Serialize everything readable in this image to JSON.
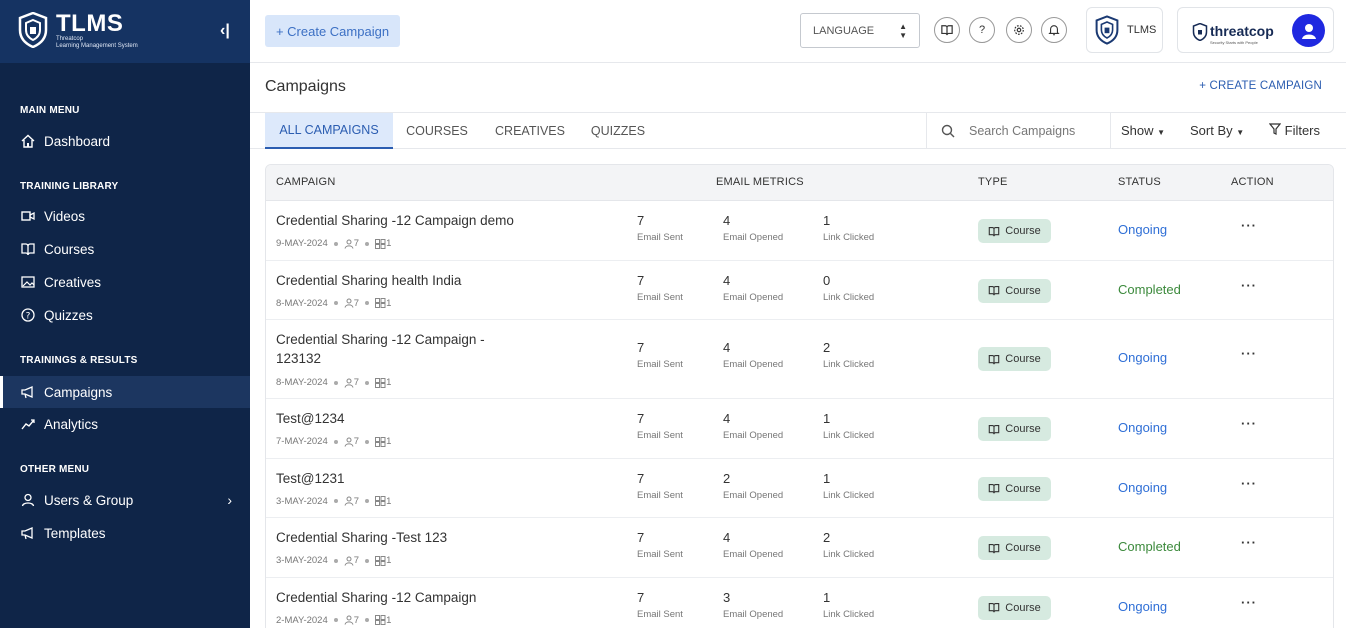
{
  "app": {
    "name": "TLMS",
    "subtitle_line1": "Threatcop",
    "subtitle_line2": "Learning Management System"
  },
  "sidebar": {
    "sections": [
      {
        "title": "MAIN MENU",
        "items": [
          {
            "label": "Dashboard",
            "icon": "home-icon"
          }
        ]
      },
      {
        "title": "TRAINING LIBRARY",
        "items": [
          {
            "label": "Videos",
            "icon": "video-icon"
          },
          {
            "label": "Courses",
            "icon": "book-icon"
          },
          {
            "label": "Creatives",
            "icon": "image-icon"
          },
          {
            "label": "Quizzes",
            "icon": "question-icon"
          }
        ]
      },
      {
        "title": "TRAININGS & RESULTS",
        "items": [
          {
            "label": "Campaigns",
            "icon": "megaphone-icon",
            "active": true
          },
          {
            "label": "Analytics",
            "icon": "chart-icon"
          }
        ]
      },
      {
        "title": "OTHER MENU",
        "items": [
          {
            "label": "Users & Group",
            "icon": "user-icon"
          },
          {
            "label": "Templates",
            "icon": "megaphone-icon"
          }
        ]
      }
    ]
  },
  "topbar": {
    "create_label": "+ Create Campaign",
    "language_label": "LANGUAGE",
    "tlms_label": "TLMS",
    "brand_name": "threatcop",
    "brand_tagline": "Security Starts with People"
  },
  "page": {
    "title": "Campaigns",
    "create_label": "+ CREATE CAMPAIGN",
    "tabs": [
      "ALL CAMPAIGNS",
      "COURSES",
      "CREATIVES",
      "QUIZZES"
    ],
    "search_placeholder": "Search Campaigns",
    "show_label": "Show",
    "sort_label": "Sort By",
    "filters_label": "Filters"
  },
  "table": {
    "headers": {
      "campaign": "CAMPAIGN",
      "email": "EMAIL METRICS",
      "type": "TYPE",
      "status": "STATUS",
      "action": "ACTION"
    },
    "metric_labels": {
      "sent": "Email Sent",
      "opened": "Email Opened",
      "clicked": "Link Clicked"
    },
    "status_colors": {
      "Ongoing": "#2f6fd6",
      "Completed": "#3c8a3c"
    },
    "rows": [
      {
        "name": "Credential Sharing -12 Campaign demo",
        "date": "9-MAY-2024",
        "users": "7",
        "groups": "1",
        "sent": "7",
        "opened": "4",
        "clicked": "1",
        "type": "Course",
        "status": "Ongoing"
      },
      {
        "name": "Credential Sharing health India",
        "date": "8-MAY-2024",
        "users": "7",
        "groups": "1",
        "sent": "7",
        "opened": "4",
        "clicked": "0",
        "type": "Course",
        "status": "Completed"
      },
      {
        "name": "Credential Sharing -12 Campaign - 123132",
        "date": "8-MAY-2024",
        "users": "7",
        "groups": "1",
        "sent": "7",
        "opened": "4",
        "clicked": "2",
        "type": "Course",
        "status": "Ongoing",
        "tall": true
      },
      {
        "name": "Test@1234",
        "date": "7-MAY-2024",
        "users": "7",
        "groups": "1",
        "sent": "7",
        "opened": "4",
        "clicked": "1",
        "type": "Course",
        "status": "Ongoing"
      },
      {
        "name": "Test@1231",
        "date": "3-MAY-2024",
        "users": "7",
        "groups": "1",
        "sent": "7",
        "opened": "2",
        "clicked": "1",
        "type": "Course",
        "status": "Ongoing"
      },
      {
        "name": "Credential Sharing -Test 123",
        "date": "3-MAY-2024",
        "users": "7",
        "groups": "1",
        "sent": "7",
        "opened": "4",
        "clicked": "2",
        "type": "Course",
        "status": "Completed"
      },
      {
        "name": "Credential Sharing -12 Campaign",
        "date": "2-MAY-2024",
        "users": "7",
        "groups": "1",
        "sent": "7",
        "opened": "3",
        "clicked": "1",
        "type": "Course",
        "status": "Ongoing"
      }
    ]
  }
}
